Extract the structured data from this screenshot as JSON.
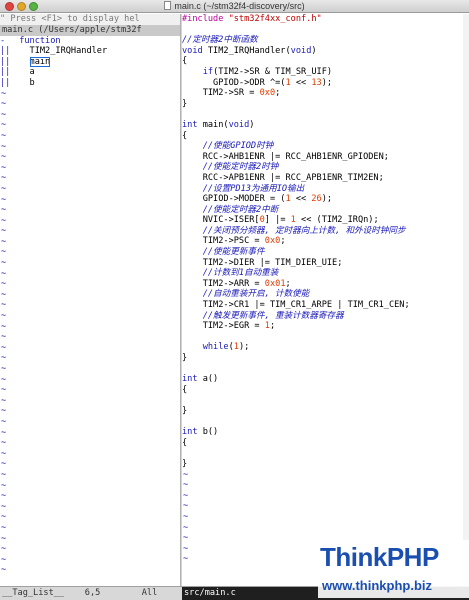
{
  "window": {
    "title": "main.c (~/stm32f4-discovery/src)"
  },
  "left": {
    "help_line": "\" Press <F1> to display hel",
    "status_path": "main.c (/Users/apple/stm32f",
    "tag_kind": "function",
    "tags": [
      "TIM2_IRQHandler",
      "main",
      "a",
      "b"
    ],
    "tilde": "~"
  },
  "right": {
    "lines": [
      {
        "k": "pp",
        "t": "#include \"stm32f4xx_conf.h\""
      },
      {
        "k": "blank",
        "t": ""
      },
      {
        "k": "cmt",
        "t": "//定时器2中断函数"
      },
      {
        "k": "code",
        "t": "void TIM2_IRQHandler(void)"
      },
      {
        "k": "code",
        "t": "{"
      },
      {
        "k": "code",
        "t": "    if(TIM2->SR & TIM_SR_UIF)"
      },
      {
        "k": "code",
        "t": "      GPIOD->ODR ^=(1 << 13);"
      },
      {
        "k": "code",
        "t": "    TIM2->SR = 0x0;"
      },
      {
        "k": "code",
        "t": "}"
      },
      {
        "k": "blank",
        "t": ""
      },
      {
        "k": "code",
        "t": "int main(void)"
      },
      {
        "k": "code",
        "t": "{"
      },
      {
        "k": "cmt",
        "t": "    //使能GPIOD时钟"
      },
      {
        "k": "code",
        "t": "    RCC->AHB1ENR |= RCC_AHB1ENR_GPIODEN;"
      },
      {
        "k": "cmt",
        "t": "    //使能定时器2时钟"
      },
      {
        "k": "code",
        "t": "    RCC->APB1ENR |= RCC_APB1ENR_TIM2EN;"
      },
      {
        "k": "cmt",
        "t": "    //设置PD13为通用IO输出"
      },
      {
        "k": "code",
        "t": "    GPIOD->MODER = (1 << 26);"
      },
      {
        "k": "cmt",
        "t": "    //使能定时器2中断"
      },
      {
        "k": "code",
        "t": "    NVIC->ISER[0] |= 1 << (TIM2_IRQn);"
      },
      {
        "k": "cmt",
        "t": "    //关闭预分频器, 定时器向上计数, 和外设时钟同步"
      },
      {
        "k": "code",
        "t": "    TIM2->PSC = 0x0;"
      },
      {
        "k": "cmt",
        "t": "    //使能更新事件"
      },
      {
        "k": "code",
        "t": "    TIM2->DIER |= TIM_DIER_UIE;"
      },
      {
        "k": "cmt",
        "t": "    //计数到1自动重装"
      },
      {
        "k": "code",
        "t": "    TIM2->ARR = 0x01;"
      },
      {
        "k": "cmt",
        "t": "    //自动重装开启, 计数使能"
      },
      {
        "k": "code",
        "t": "    TIM2->CR1 |= TIM_CR1_ARPE | TIM_CR1_CEN;"
      },
      {
        "k": "cmt",
        "t": "    //触发更新事件, 重装计数器寄存器"
      },
      {
        "k": "code",
        "t": "    TIM2->EGR = 1;"
      },
      {
        "k": "blank",
        "t": ""
      },
      {
        "k": "code",
        "t": "    while(1);"
      },
      {
        "k": "code",
        "t": "}"
      },
      {
        "k": "blank",
        "t": ""
      },
      {
        "k": "code",
        "t": "int a()"
      },
      {
        "k": "code",
        "t": "{"
      },
      {
        "k": "blank",
        "t": ""
      },
      {
        "k": "code",
        "t": "}"
      },
      {
        "k": "blank",
        "t": ""
      },
      {
        "k": "code",
        "t": "int b()"
      },
      {
        "k": "code",
        "t": "{"
      },
      {
        "k": "blank",
        "t": ""
      },
      {
        "k": "code",
        "t": "}"
      }
    ]
  },
  "status": {
    "left_name": "__Tag_List__",
    "left_pos": "6,5",
    "left_all": "All",
    "right_file": "src/main.c"
  },
  "watermark": {
    "logo": "ThinkPHP",
    "url": "www.thinkphp.biz"
  },
  "colors": {
    "keyword": "#1a1ab8",
    "preproc": "#b8009d",
    "string": "#c20000",
    "number": "#e33b00",
    "comment": "#1a1ab8"
  }
}
